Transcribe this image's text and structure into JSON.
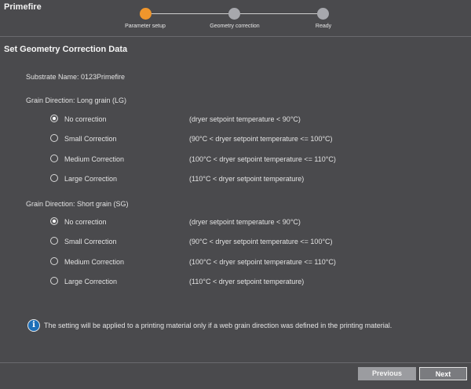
{
  "app": {
    "title": "Primefire"
  },
  "stepper": {
    "steps": [
      {
        "label": "Parameter setup",
        "state": "active"
      },
      {
        "label": "Geometry correction",
        "state": "pending"
      },
      {
        "label": "Ready",
        "state": "pending"
      }
    ],
    "active_color": "#f0962c",
    "pending_color": "#a7a8ad"
  },
  "main": {
    "title": "Set Geometry Correction Data",
    "substrate_label": "Substrate Name: 0123Primefire",
    "groups": [
      {
        "label": "Grain Direction: Long grain (LG)",
        "options": [
          {
            "label": "No correction",
            "condition": "(dryer setpoint temperature < 90°C)",
            "selected": true
          },
          {
            "label": "Small Correction",
            "condition": "(90°C < dryer setpoint temperature <= 100°C)",
            "selected": false
          },
          {
            "label": "Medium Correction",
            "condition": "(100°C < dryer setpoint temperature <= 110°C)",
            "selected": false
          },
          {
            "label": "Large Correction",
            "condition": "(110°C < dryer setpoint temperature)",
            "selected": false
          }
        ]
      },
      {
        "label": "Grain Direction: Short grain (SG)",
        "options": [
          {
            "label": "No correction",
            "condition": "(dryer setpoint temperature < 90°C)",
            "selected": true
          },
          {
            "label": "Small Correction",
            "condition": "(90°C < dryer setpoint temperature <= 100°C)",
            "selected": false
          },
          {
            "label": "Medium Correction",
            "condition": "(100°C < dryer setpoint temperature <= 110°C)",
            "selected": false
          },
          {
            "label": "Large Correction",
            "condition": "(110°C < dryer setpoint temperature)",
            "selected": false
          }
        ]
      }
    ],
    "info_icon": "info-icon",
    "info_text": "The setting will be applied to a printing material only if a web grain direction was defined in the printing material."
  },
  "footer": {
    "previous_label": "Previous",
    "next_label": "Next"
  }
}
